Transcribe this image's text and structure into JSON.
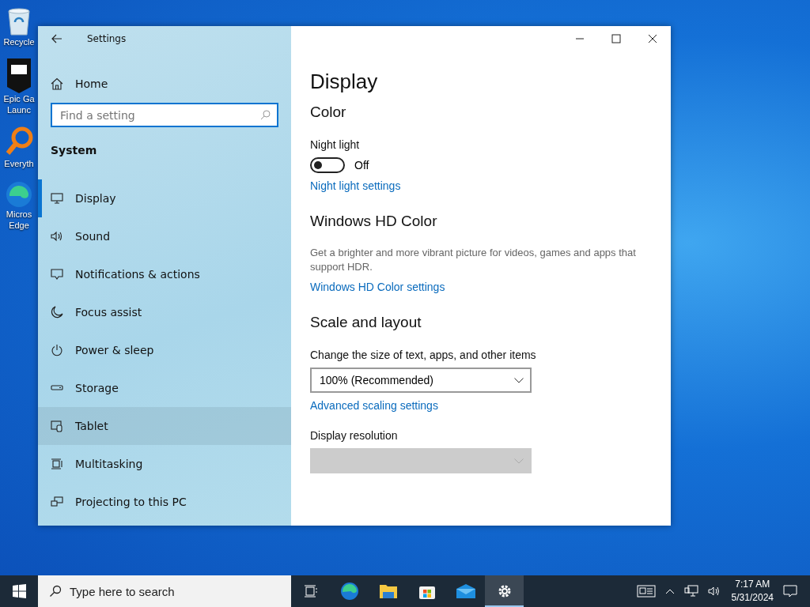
{
  "desktop_icons": [
    {
      "kind": "recycle",
      "lines": [
        "Recycle"
      ]
    },
    {
      "kind": "epic",
      "lines": [
        "Epic Ga",
        "Launc"
      ]
    },
    {
      "kind": "everything",
      "lines": [
        "Everyth"
      ]
    },
    {
      "kind": "edge",
      "lines": [
        "Micros",
        "Edge"
      ]
    }
  ],
  "window": {
    "title": "Settings"
  },
  "sidebar": {
    "home": "Home",
    "search": {
      "placeholder": "Find a setting"
    },
    "section": "System",
    "items": [
      {
        "label": "Display",
        "kind": "display",
        "selected": true,
        "hovered": false
      },
      {
        "label": "Sound",
        "kind": "sound",
        "selected": false,
        "hovered": false
      },
      {
        "label": "Notifications & actions",
        "kind": "notifications",
        "selected": false,
        "hovered": false
      },
      {
        "label": "Focus assist",
        "kind": "focus",
        "selected": false,
        "hovered": false
      },
      {
        "label": "Power & sleep",
        "kind": "power",
        "selected": false,
        "hovered": false
      },
      {
        "label": "Storage",
        "kind": "storage",
        "selected": false,
        "hovered": false
      },
      {
        "label": "Tablet",
        "kind": "tablet",
        "selected": false,
        "hovered": true
      },
      {
        "label": "Multitasking",
        "kind": "multitasking",
        "selected": false,
        "hovered": false
      },
      {
        "label": "Projecting to this PC",
        "kind": "projecting",
        "selected": false,
        "hovered": false
      }
    ]
  },
  "content": {
    "title": "Display",
    "blocks": [
      {
        "kind": "heading",
        "text": "Color"
      },
      {
        "kind": "label",
        "text": "Night light"
      },
      {
        "kind": "toggle",
        "on": false,
        "text": "Off"
      },
      {
        "kind": "link",
        "text": "Night light settings"
      },
      {
        "kind": "heading",
        "text": "Windows HD Color"
      },
      {
        "kind": "text",
        "text": "Get a brighter and more vibrant picture for videos, games and apps that support HDR."
      },
      {
        "kind": "link",
        "text": "Windows HD Color settings"
      },
      {
        "kind": "heading",
        "text": "Scale and layout"
      },
      {
        "kind": "label",
        "text": "Change the size of text, apps, and other items"
      },
      {
        "kind": "dropdown",
        "value": "100% (Recommended)",
        "disabled": false
      },
      {
        "kind": "link",
        "text": "Advanced scaling settings"
      },
      {
        "kind": "label",
        "text": "Display resolution"
      },
      {
        "kind": "dropdown",
        "disabled": true
      }
    ]
  },
  "taskbar": {
    "search": {
      "placeholder": "Type here to search"
    },
    "apps": [
      {
        "kind": "taskview",
        "active": false
      },
      {
        "kind": "edge",
        "active": false
      },
      {
        "kind": "explorer",
        "active": false
      },
      {
        "kind": "store",
        "active": false
      },
      {
        "kind": "mail",
        "active": false
      },
      {
        "kind": "settings",
        "active": true
      }
    ],
    "time": "7:17 AM",
    "date": "5/31/2024"
  }
}
